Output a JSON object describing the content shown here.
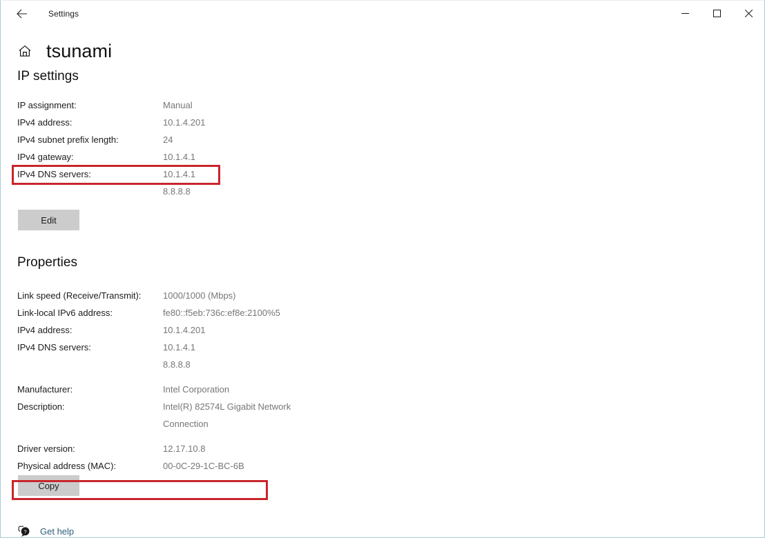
{
  "window": {
    "titlebar_title": "Settings",
    "back_icon": "back-arrow-icon",
    "minimize_label": "Minimize",
    "maximize_label": "Maximize",
    "close_label": "Close"
  },
  "page": {
    "home_icon": "home-icon",
    "title": "tsunami"
  },
  "ip_settings": {
    "heading": "IP settings",
    "rows": [
      {
        "label": "IP assignment:",
        "value": "Manual"
      },
      {
        "label": "IPv4 address:",
        "value": "10.1.4.201"
      },
      {
        "label": "IPv4 subnet prefix length:",
        "value": "24"
      },
      {
        "label": "IPv4 gateway:",
        "value": "10.1.4.1"
      },
      {
        "label": "IPv4 DNS servers:",
        "value": "10.1.4.1\n8.8.8.8"
      }
    ],
    "edit_button": "Edit"
  },
  "properties": {
    "heading": "Properties",
    "rows": [
      {
        "label": "Link speed (Receive/Transmit):",
        "value": "1000/1000 (Mbps)"
      },
      {
        "label": "Link-local IPv6 address:",
        "value": "fe80::f5eb:736c:ef8e:2100%5"
      },
      {
        "label": "IPv4 address:",
        "value": "10.1.4.201"
      },
      {
        "label": "IPv4 DNS servers:",
        "value": "10.1.4.1\n8.8.8.8"
      },
      {
        "label": "Manufacturer:",
        "value": "Intel Corporation"
      },
      {
        "label": "Description:",
        "value": "Intel(R) 82574L Gigabit Network Connection"
      },
      {
        "label": "Driver version:",
        "value": "12.17.10.8"
      },
      {
        "label": "Physical address (MAC):",
        "value": "00-0C-29-1C-BC-6B"
      }
    ],
    "copy_button": "Copy"
  },
  "footer": {
    "help_icon": "help-bubble-icon",
    "help_label": "Get help"
  },
  "colors": {
    "annotation_red": "#c8252b",
    "link_blue": "#2d5f7c",
    "value_gray": "#767676",
    "button_gray": "#cccccc",
    "window_border": "#a8cdd7"
  }
}
